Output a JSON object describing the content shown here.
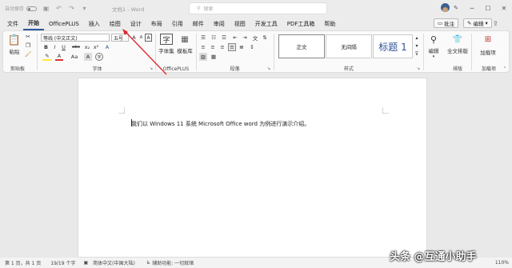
{
  "titlebar": {
    "autosave": "自动保存",
    "title": "文档1 - Word",
    "search_placeholder": "搜索",
    "window_controls": [
      "─",
      "☐",
      "✕"
    ]
  },
  "menu": {
    "items": [
      "文件",
      "开始",
      "OfficePLUS",
      "插入",
      "绘图",
      "设计",
      "布局",
      "引用",
      "邮件",
      "审阅",
      "视图",
      "开发工具",
      "PDF工具箱",
      "帮助"
    ],
    "active": "开始",
    "comment_btn": "批注",
    "edit_btn": "编辑"
  },
  "ribbon": {
    "clipboard": {
      "paste": "粘贴",
      "label": "剪贴板"
    },
    "font": {
      "name": "等线 (中文正文)",
      "size": "五号",
      "label": "字体",
      "buttons": [
        "B",
        "I",
        "U",
        "abc",
        "x₂",
        "x²",
        "A",
        "A",
        "Aa",
        "A"
      ]
    },
    "officeplus": {
      "b1": "字体集",
      "b2": "模板库",
      "label": "OfficePLUS"
    },
    "paragraph": {
      "label": "段落"
    },
    "styles": {
      "s1": "正文",
      "s2": "无间隔",
      "s3": "标题 1",
      "label": "样式"
    },
    "editing": {
      "b1": "编辑",
      "label": ""
    },
    "arrange": {
      "b1": "全文排版",
      "label": "排版"
    },
    "addins": {
      "b1": "加载项",
      "label": "加载项"
    }
  },
  "document": {
    "text": "我们以 Windows 11 系统 Microsoft Office word 为例进行演示介绍。"
  },
  "status": {
    "page": "第 1 页，共 1 页",
    "words": "19/19 个字",
    "language": "简体中文(中国大陆)",
    "accessibility": "辅助功能: 一切就绪",
    "zoom": "110%"
  },
  "watermark": "头条 @互通小助手"
}
